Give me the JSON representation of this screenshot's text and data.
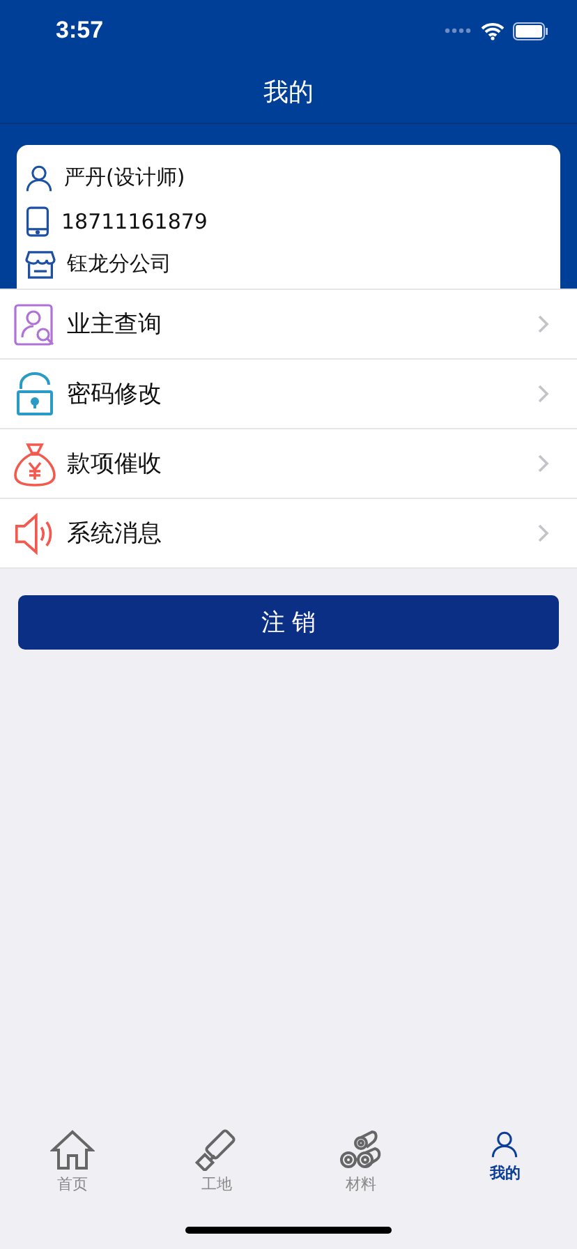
{
  "status_bar": {
    "time": "3:57"
  },
  "header": {
    "title": "我的"
  },
  "profile": [
    {
      "kind": "person",
      "text": "严丹(设计师)"
    },
    {
      "kind": "phone",
      "text": "18711161879"
    },
    {
      "kind": "store",
      "text": "钰龙分公司"
    }
  ],
  "menu": [
    {
      "kind": "owner",
      "label": "业主查询"
    },
    {
      "kind": "lock",
      "label": "密码修改"
    },
    {
      "kind": "money",
      "label": "款项催收"
    },
    {
      "kind": "speaker",
      "label": "系统消息"
    }
  ],
  "logout_button": "注 销",
  "tab_bar": [
    {
      "kind": "home",
      "label": "首页",
      "selected": false
    },
    {
      "kind": "roller",
      "label": "工地",
      "selected": false
    },
    {
      "kind": "rolls",
      "label": "材料",
      "selected": false
    },
    {
      "kind": "person",
      "label": "我的",
      "selected": true
    }
  ]
}
